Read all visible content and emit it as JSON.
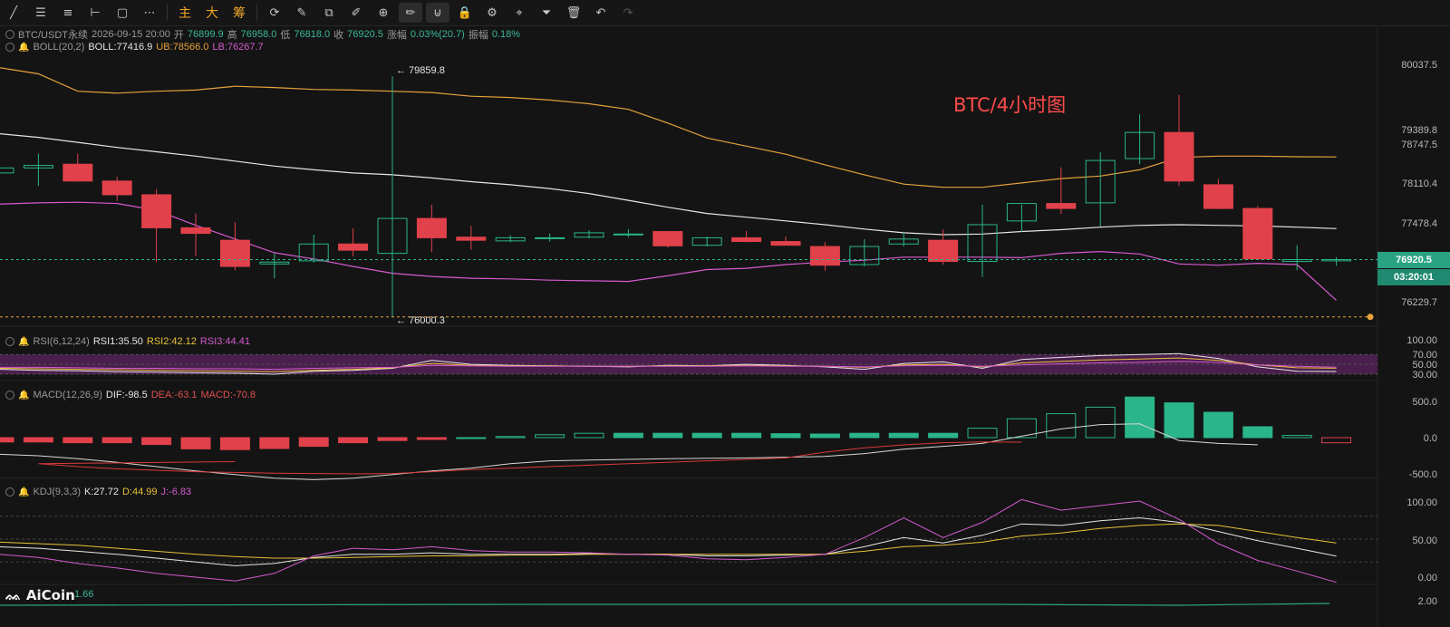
{
  "toolbar": {
    "tools": [
      {
        "name": "trend-line-icon",
        "glyph": "╱"
      },
      {
        "name": "horizontal-lines-icon",
        "glyph": "☰"
      },
      {
        "name": "parallel-lines-icon",
        "glyph": "≡"
      },
      {
        "name": "ray-icon",
        "glyph": "⊢"
      },
      {
        "name": "rectangle-icon",
        "glyph": "▢"
      },
      {
        "name": "dotted-line-icon",
        "glyph": "⋯"
      }
    ],
    "cn_buttons": [
      "主",
      "大",
      "筹"
    ],
    "tools2": [
      {
        "name": "refresh-icon",
        "glyph": "⟳"
      },
      {
        "name": "brush-icon",
        "glyph": "✎"
      },
      {
        "name": "layers-icon",
        "glyph": "⧉"
      },
      {
        "name": "ruler-icon",
        "glyph": "✐"
      },
      {
        "name": "zoom-icon",
        "glyph": "⊕"
      },
      {
        "name": "pencil-icon",
        "glyph": "✏"
      },
      {
        "name": "magnet-icon",
        "glyph": "⊍"
      },
      {
        "name": "lock-icon",
        "glyph": "🔒"
      },
      {
        "name": "settings-icon",
        "glyph": "⚙"
      },
      {
        "name": "pin-icon",
        "glyph": "⌖"
      },
      {
        "name": "filter-icon",
        "glyph": "⏷"
      },
      {
        "name": "trash-icon",
        "glyph": "🗑"
      },
      {
        "name": "undo-icon",
        "glyph": "↶"
      },
      {
        "name": "redo-icon",
        "glyph": "↷"
      }
    ]
  },
  "header": {
    "symbol": "BTC/USDT永续",
    "datetime": "2026-09-15 20:00",
    "open_label": "开",
    "open": "76899.9",
    "high_label": "高",
    "high": "76958.0",
    "low_label": "低",
    "low": "76818.0",
    "close_label": "收",
    "close": "76920.5",
    "change_label": "涨幅",
    "change": "0.03%(20.7)",
    "amp_label": "振幅",
    "amp": "0.18%"
  },
  "boll": {
    "label": "BOLL(20,2)",
    "mid": "BOLL:77416.9",
    "ub": "UB:78566.0",
    "lb": "LB:76267.7"
  },
  "rsi": {
    "label": "RSI(6,12,24)",
    "r1": "RSI1:35.50",
    "r2": "RSI2:42.12",
    "r3": "RSI3:44.41"
  },
  "macd": {
    "label": "MACD(12,26,9)",
    "dif": "DIF:-98.5",
    "dea": "DEA:-63.1",
    "macd": "MACD:-70.8"
  },
  "kdj": {
    "label": "KDJ(9,3,3)",
    "k": "K:27.72",
    "d": "D:44.99",
    "j": "J:-6.83"
  },
  "vol": {
    "label": "1.66"
  },
  "annotation": "BTC/4小时图",
  "high_marker": "← 79859.8",
  "low_marker": "← 76000.3",
  "current_price": "76920.5",
  "countdown": "03:20:01",
  "logo": "AiCoin",
  "axes": {
    "price": [
      "80037.5",
      "79389.8",
      "78747.5",
      "78110.4",
      "77478.4",
      "76229.7"
    ],
    "rsi": [
      "100.00",
      "70.00",
      "50.00",
      "30.00"
    ],
    "macd": [
      "500.0",
      "0.0",
      "-500.0"
    ],
    "kdj": [
      "100.00",
      "50.00",
      "0.00"
    ],
    "vol": [
      "2.00"
    ]
  },
  "colors": {
    "up": "#2ab58a",
    "down": "#e0414a",
    "bg": "#141414",
    "accent": "#f0a526"
  },
  "chart_data": {
    "type": "candlestick",
    "candles": [
      {
        "o": 78310,
        "h": 78420,
        "l": 78150,
        "c": 78390
      },
      {
        "o": 78390,
        "h": 78620,
        "l": 78100,
        "c": 78430
      },
      {
        "o": 78450,
        "h": 78620,
        "l": 78170,
        "c": 78180
      },
      {
        "o": 78180,
        "h": 78250,
        "l": 77860,
        "c": 77960
      },
      {
        "o": 77960,
        "h": 78050,
        "l": 76880,
        "c": 77430
      },
      {
        "o": 77430,
        "h": 77660,
        "l": 76980,
        "c": 77340
      },
      {
        "o": 77230,
        "h": 77520,
        "l": 76750,
        "c": 76810
      },
      {
        "o": 76850,
        "h": 77020,
        "l": 76620,
        "c": 76880
      },
      {
        "o": 76900,
        "h": 77320,
        "l": 76870,
        "c": 77170
      },
      {
        "o": 77170,
        "h": 77420,
        "l": 76970,
        "c": 77070
      },
      {
        "o": 77020,
        "h": 79859.8,
        "l": 76000.3,
        "c": 77580
      },
      {
        "o": 77580,
        "h": 77800,
        "l": 77040,
        "c": 77270
      },
      {
        "o": 77280,
        "h": 77460,
        "l": 77080,
        "c": 77230
      },
      {
        "o": 77220,
        "h": 77310,
        "l": 77200,
        "c": 77270
      },
      {
        "o": 77260,
        "h": 77340,
        "l": 77210,
        "c": 77270
      },
      {
        "o": 77280,
        "h": 77390,
        "l": 77260,
        "c": 77350
      },
      {
        "o": 77320,
        "h": 77410,
        "l": 77280,
        "c": 77330
      },
      {
        "o": 77370,
        "h": 77380,
        "l": 77110,
        "c": 77140
      },
      {
        "o": 77150,
        "h": 77290,
        "l": 77130,
        "c": 77270
      },
      {
        "o": 77270,
        "h": 77380,
        "l": 77200,
        "c": 77210
      },
      {
        "o": 77210,
        "h": 77290,
        "l": 77160,
        "c": 77150
      },
      {
        "o": 77130,
        "h": 77200,
        "l": 76740,
        "c": 76830
      },
      {
        "o": 76840,
        "h": 77250,
        "l": 76810,
        "c": 77130
      },
      {
        "o": 77170,
        "h": 77370,
        "l": 77130,
        "c": 77250
      },
      {
        "o": 77230,
        "h": 77400,
        "l": 76840,
        "c": 76890
      },
      {
        "o": 76890,
        "h": 77800,
        "l": 76640,
        "c": 77480
      },
      {
        "o": 77540,
        "h": 77800,
        "l": 77360,
        "c": 77820
      },
      {
        "o": 77820,
        "h": 78400,
        "l": 77650,
        "c": 77740
      },
      {
        "o": 77830,
        "h": 78640,
        "l": 77450,
        "c": 78510
      },
      {
        "o": 78540,
        "h": 79250,
        "l": 78450,
        "c": 78960
      },
      {
        "o": 78960,
        "h": 79560,
        "l": 78100,
        "c": 78180
      },
      {
        "o": 78120,
        "h": 78210,
        "l": 77730,
        "c": 77740
      },
      {
        "o": 77740,
        "h": 77780,
        "l": 76920,
        "c": 76930
      },
      {
        "o": 76890,
        "h": 77150,
        "l": 76750,
        "c": 76920
      },
      {
        "o": 76900,
        "h": 76960,
        "l": 76820,
        "c": 76920
      }
    ],
    "boll_ub": [
      80000,
      79900,
      79620,
      79590,
      79620,
      79640,
      79700,
      79680,
      79650,
      79640,
      79620,
      79600,
      79540,
      79520,
      79480,
      79420,
      79330,
      79110,
      78870,
      78740,
      78610,
      78440,
      78280,
      78130,
      78080,
      78080,
      78150,
      78220,
      78260,
      78360,
      78560,
      78580,
      78580,
      78570,
      78566
    ],
    "boll_mid": [
      78940,
      78880,
      78800,
      78720,
      78650,
      78580,
      78500,
      78420,
      78360,
      78310,
      78280,
      78230,
      78170,
      78120,
      78060,
      77980,
      77870,
      77760,
      77660,
      77600,
      77540,
      77480,
      77410,
      77350,
      77320,
      77330,
      77370,
      77400,
      77440,
      77470,
      77480,
      77470,
      77460,
      77440,
      77417
    ],
    "boll_lb": [
      77810,
      77830,
      77840,
      77820,
      77710,
      77470,
      77250,
      77030,
      76930,
      76810,
      76700,
      76650,
      76620,
      76610,
      76590,
      76580,
      76570,
      76660,
      76760,
      76780,
      76840,
      76880,
      76910,
      76960,
      76960,
      76960,
      76950,
      77020,
      77050,
      77010,
      76850,
      76830,
      76860,
      76840,
      76268
    ],
    "rsi": [
      {
        "name": "RSI1",
        "values": [
          40,
          38,
          37,
          35,
          34,
          33,
          32,
          30,
          36,
          38,
          42,
          58,
          50,
          48,
          47,
          46,
          45,
          48,
          47,
          50,
          48,
          45,
          40,
          52,
          55,
          42,
          60,
          64,
          68,
          70,
          72,
          62,
          45,
          36,
          35.5
        ]
      },
      {
        "name": "RSI2",
        "values": [
          42,
          41,
          40,
          39,
          38,
          37,
          36,
          35,
          38,
          40,
          43,
          52,
          48,
          47,
          47,
          46,
          46,
          47,
          47,
          48,
          47,
          46,
          44,
          49,
          50,
          45,
          53,
          56,
          59,
          61,
          63,
          58,
          49,
          43,
          42.1
        ]
      },
      {
        "name": "RSI3",
        "values": [
          44,
          44,
          43,
          42,
          42,
          41,
          41,
          40,
          42,
          43,
          44,
          48,
          47,
          46,
          46,
          46,
          46,
          46,
          46,
          47,
          46,
          46,
          45,
          47,
          48,
          46,
          49,
          51,
          53,
          54,
          56,
          54,
          49,
          46,
          44.4
        ]
      }
    ],
    "macd_hist": [
      -60,
      -60,
      -70,
      -70,
      -95,
      -155,
      -165,
      -150,
      -120,
      -70,
      -40,
      -25,
      0,
      15,
      40,
      60,
      60,
      60,
      60,
      60,
      55,
      50,
      60,
      60,
      60,
      130,
      260,
      330,
      420,
      560,
      480,
      350,
      150,
      30,
      -70.8
    ],
    "macd_dif": [
      -230,
      -250,
      -290,
      -340,
      -400,
      -460,
      -510,
      -560,
      -580,
      -560,
      -510,
      -460,
      -420,
      -360,
      -320,
      -310,
      -300,
      -290,
      -285,
      -280,
      -270,
      -260,
      -220,
      -160,
      -120,
      -80,
      20,
      120,
      180,
      190,
      -40,
      -80,
      -98.5
    ],
    "macd_dea": [
      -330,
      -360,
      -400,
      -430,
      -450,
      -470,
      -480,
      -490,
      -495,
      -500,
      -495,
      -470,
      -440,
      -420,
      -400,
      -380,
      -360,
      -340,
      -320,
      -300,
      -280,
      -200,
      -140,
      -100,
      -70,
      -60,
      -63.1
    ],
    "kdj": [
      {
        "name": "K",
        "values": [
          40,
          38,
          34,
          30,
          25,
          20,
          15,
          18,
          26,
          30,
          30,
          32,
          30,
          30,
          30,
          31,
          30,
          30,
          28,
          28,
          29,
          30,
          40,
          52,
          45,
          55,
          70,
          68,
          74,
          78,
          72,
          60,
          48,
          38,
          27.7
        ]
      },
      {
        "name": "D",
        "values": [
          46,
          44,
          42,
          38,
          34,
          30,
          27,
          25,
          25,
          26,
          27,
          28,
          28,
          29,
          29,
          30,
          30,
          30,
          30,
          30,
          30,
          30,
          34,
          40,
          42,
          46,
          54,
          58,
          64,
          68,
          70,
          68,
          60,
          52,
          45
        ]
      },
      {
        "name": "J",
        "values": [
          30,
          26,
          18,
          12,
          5,
          0,
          -5,
          5,
          28,
          38,
          36,
          40,
          35,
          33,
          33,
          32,
          30,
          29,
          24,
          23,
          26,
          30,
          52,
          78,
          52,
          72,
          102,
          88,
          94,
          100,
          76,
          44,
          22,
          8,
          -6.8
        ]
      }
    ]
  }
}
